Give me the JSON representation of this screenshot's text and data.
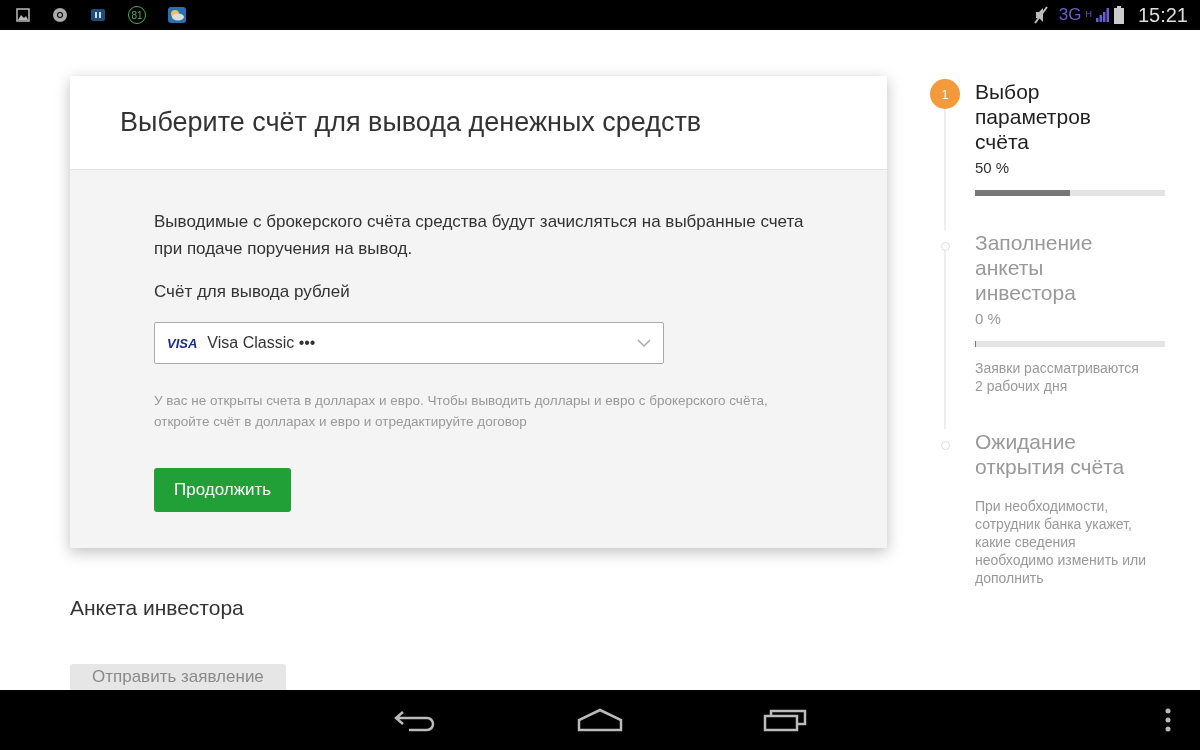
{
  "status_bar": {
    "notification_badge": "81",
    "network": "3G",
    "network_sub": "H",
    "time": "15:21"
  },
  "card": {
    "title": "Выберите счёт для вывода денежных средств",
    "description": "Выводимые с брокерского счёта средства будут зачисляться на выбранные счета при подаче поручения на вывод.",
    "field_label": "Счёт для вывода рублей",
    "select": {
      "brand": "VISA",
      "value": "Visa Classic •••"
    },
    "note": "У вас не открыты счета в долларах и евро. Чтобы выводить доллары и евро с брокерского счёта, откройте счёт в долларах и евро и отредактируйте договор",
    "button": "Продолжить"
  },
  "section": {
    "title": "Анкета инвестора",
    "button": "Отправить заявление",
    "button_disabled": true
  },
  "steps": [
    {
      "number": "1",
      "title": "Выбор параметров счёта",
      "percent": "50 %",
      "level": 0.5,
      "selected": true
    },
    {
      "title": "Заполнение анкеты инвестора",
      "percent": "0 %",
      "level": 0,
      "note": "Заявки рассматриваются 2 рабочих дня",
      "selected": false
    },
    {
      "title": "Ожидание открытия счёта",
      "note": "При необходимости, сотрудник банка укажет, какие сведения необходимо изменить или дополнить",
      "selected": false
    }
  ]
}
